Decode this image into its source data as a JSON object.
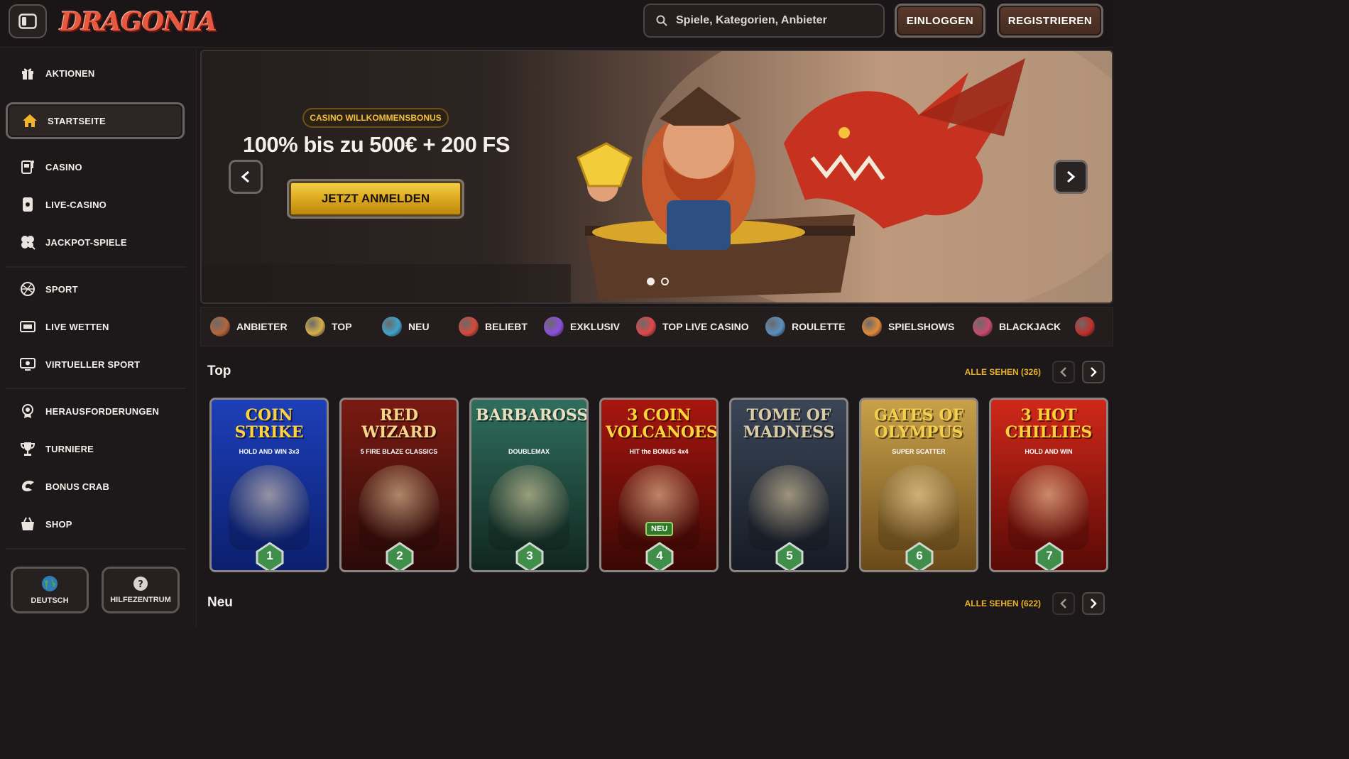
{
  "brand": {
    "logo_text": "DRAGONIA"
  },
  "header": {
    "search_placeholder": "Spiele, Kategorien, Anbieter",
    "login_label": "EINLOGGEN",
    "register_label": "REGISTRIEREN"
  },
  "sidebar": {
    "items": [
      {
        "label": "AKTIONEN",
        "icon": "gift-icon"
      },
      {
        "label": "STARTSEITE",
        "icon": "home-icon",
        "active": true
      },
      {
        "label": "CASINO",
        "icon": "slot-machine-icon"
      },
      {
        "label": "LIVE-CASINO",
        "icon": "live-card-icon"
      },
      {
        "label": "JACKPOT-SPIELE",
        "icon": "clover-icon"
      },
      {
        "label": "SPORT",
        "icon": "soccer-ball-icon"
      },
      {
        "label": "LIVE WETTEN",
        "icon": "live-badge-icon"
      },
      {
        "label": "VIRTUELLER SPORT",
        "icon": "monitor-icon"
      },
      {
        "label": "HERAUSFORDERUNGEN",
        "icon": "medal-icon"
      },
      {
        "label": "TURNIERE",
        "icon": "trophy-icon"
      },
      {
        "label": "BONUS CRAB",
        "icon": "claw-icon"
      },
      {
        "label": "SHOP",
        "icon": "basket-icon"
      }
    ],
    "language_label": "DEUTSCH",
    "help_label": "HILFEZENTRUM"
  },
  "banner": {
    "tag": "CASINO WILLKOMMENSBONUS",
    "headline": "100% bis zu 500€ + 200 FS",
    "cta": "JETZT ANMELDEN",
    "slide_count": 2,
    "active_slide": 1
  },
  "categories": [
    {
      "label": "ANBIETER",
      "color": "#b5663a"
    },
    {
      "label": "TOP",
      "color": "#d4b04a"
    },
    {
      "label": "NEU",
      "color": "#3fa3c9"
    },
    {
      "label": "BELIEBT",
      "color": "#d54a3a"
    },
    {
      "label": "EXKLUSIV",
      "color": "#8c4fe0"
    },
    {
      "label": "TOP LIVE CASINO",
      "color": "#e04848"
    },
    {
      "label": "ROULETTE",
      "color": "#5a8fbf"
    },
    {
      "label": "SPIELSHOWS",
      "color": "#e08a3a"
    },
    {
      "label": "BLACKJACK",
      "color": "#c94a6e"
    }
  ],
  "sections": {
    "top": {
      "title": "Top",
      "see_all": "ALLE SEHEN (326)"
    },
    "new": {
      "title": "Neu",
      "see_all": "ALLE SEHEN (622)"
    }
  },
  "games": [
    {
      "title": "COIN STRIKE",
      "subtitle": "HOLD AND WIN 3x3",
      "rank": "1",
      "bg": [
        "#1d3fb8",
        "#0b1f6e"
      ],
      "title_color": "#ffd23a"
    },
    {
      "title": "RED WIZARD",
      "subtitle": "5 FIRE BLAZE CLASSICS",
      "rank": "2",
      "bg": [
        "#7a1a12",
        "#2a0a08"
      ],
      "title_color": "#f5d58c"
    },
    {
      "title": "BARBAROSSA",
      "subtitle": "DOUBLEMAX",
      "rank": "3",
      "bg": [
        "#2f6e5d",
        "#10261f"
      ],
      "title_color": "#e9dfc0"
    },
    {
      "title": "3 COIN VOLCANOES",
      "subtitle": "HIT the BONUS 4x4",
      "badge": "NEU",
      "rank": "4",
      "bg": [
        "#a8160f",
        "#3a0704"
      ],
      "title_color": "#ffd43a"
    },
    {
      "title": "TOME OF MADNESS",
      "subtitle": "",
      "rank": "5",
      "bg": [
        "#3a4556",
        "#161b25"
      ],
      "title_color": "#d8cba6"
    },
    {
      "title": "GATES OF OLYMPUS",
      "subtitle": "SUPER SCATTER",
      "rank": "6",
      "bg": [
        "#c9a14a",
        "#6a4a1a"
      ],
      "title_color": "#f3d04a"
    },
    {
      "title": "3 HOT CHILLIES",
      "subtitle": "HOLD AND WIN",
      "rank": "7",
      "bg": [
        "#d0281a",
        "#5a0a06"
      ],
      "title_color": "#ffd23a"
    }
  ],
  "colors": {
    "accent_gold": "#e9b22a",
    "brand_red": "#e65940",
    "rank_badge": "#3f8f4a"
  }
}
